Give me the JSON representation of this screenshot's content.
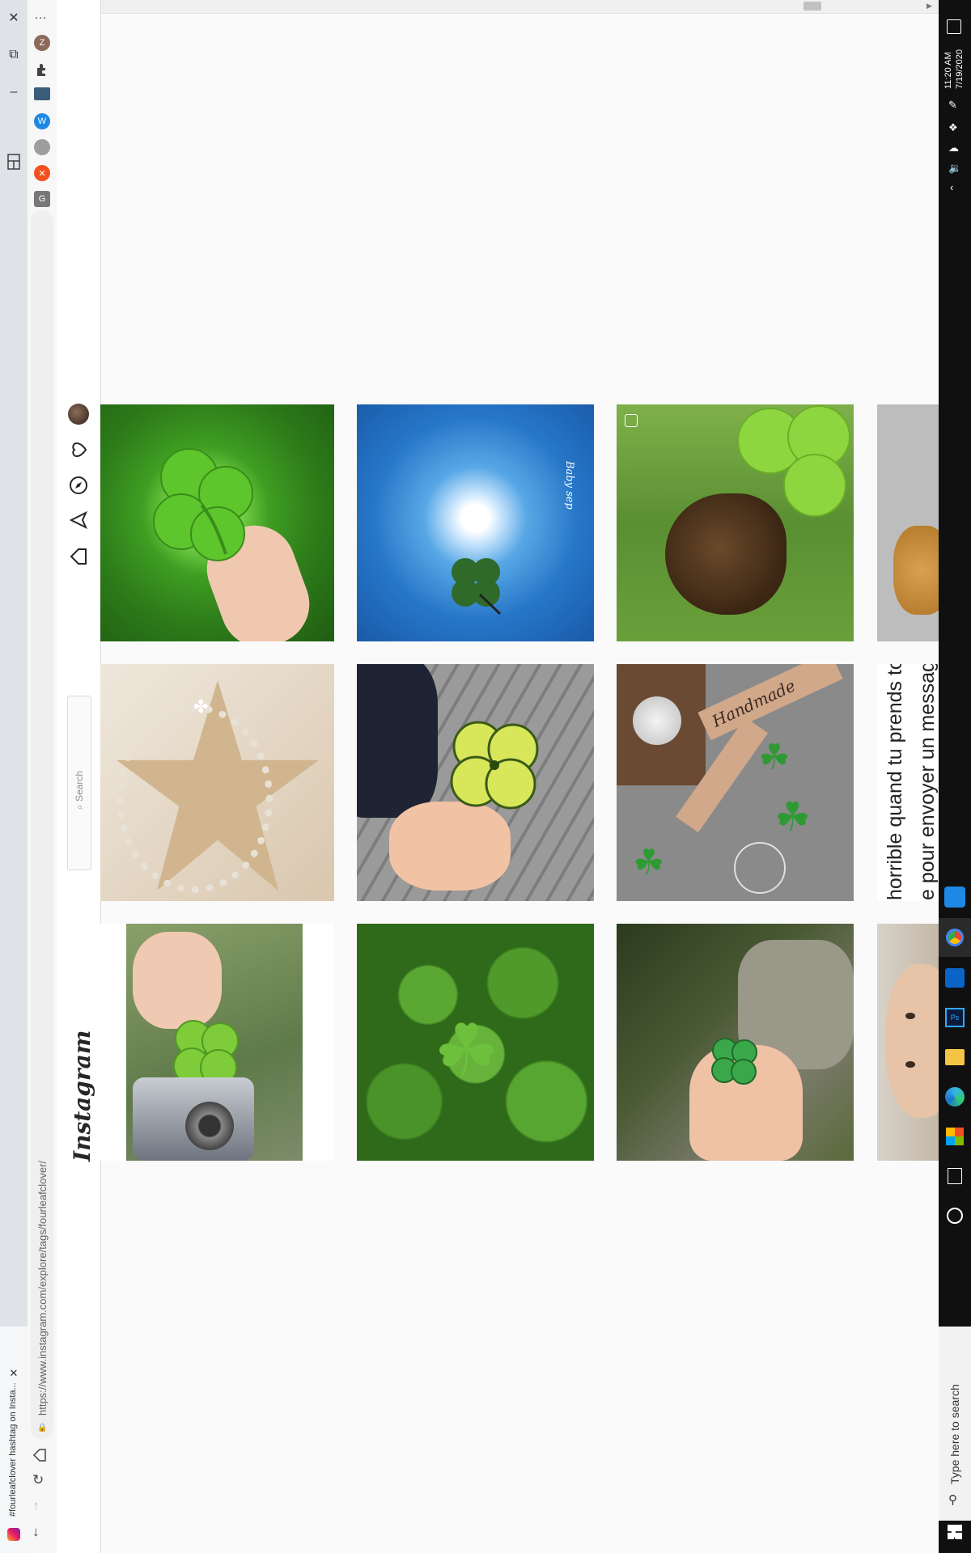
{
  "browser": {
    "tab_title": "#fourleafclover hashtag on Insta...",
    "url": "https://www.instagram.com/explore/tags/fourleafclover/",
    "profile_initial": "Z",
    "new_tab_symbol": "+",
    "menu_symbol": "…"
  },
  "instagram": {
    "logo_text": "Instagram",
    "search_placeholder": "Search",
    "nav_icons": [
      "home-icon",
      "direct-icon",
      "explore-icon",
      "activity-icon",
      "profile-avatar"
    ]
  },
  "posts": [
    {
      "id": "clover-hand-grass",
      "overlay_text": ""
    },
    {
      "id": "clover-sky-sun",
      "overlay_text": "Baby sep"
    },
    {
      "id": "clover-dog",
      "overlay_text": ""
    },
    {
      "id": "small-dog-street",
      "overlay_text": ""
    },
    {
      "id": "pearl-bracelet-star",
      "overlay_text": ""
    },
    {
      "id": "yellow-clover-wood",
      "overlay_text": ""
    },
    {
      "id": "handmade-tags",
      "overlay_text": "Handmade"
    },
    {
      "id": "text-post",
      "overlay_text": "horrible quand tu prends ton",
      "overlay_text_2": "e pour envoyer un messag"
    },
    {
      "id": "clover-camera",
      "overlay_text": ""
    },
    {
      "id": "clover-field",
      "overlay_text": ""
    },
    {
      "id": "clover-hand-rock",
      "overlay_text": ""
    },
    {
      "id": "man-face",
      "overlay_text": ""
    }
  ],
  "taskbar": {
    "time": "11:20 AM",
    "date": "7/19/2020",
    "search_placeholder": "Type here to search"
  },
  "colors": {
    "instagram_bg": "#fafafa",
    "taskbar": "#101010",
    "clover_green": "#4aa12a",
    "sky_blue": "#2a7fd0"
  }
}
